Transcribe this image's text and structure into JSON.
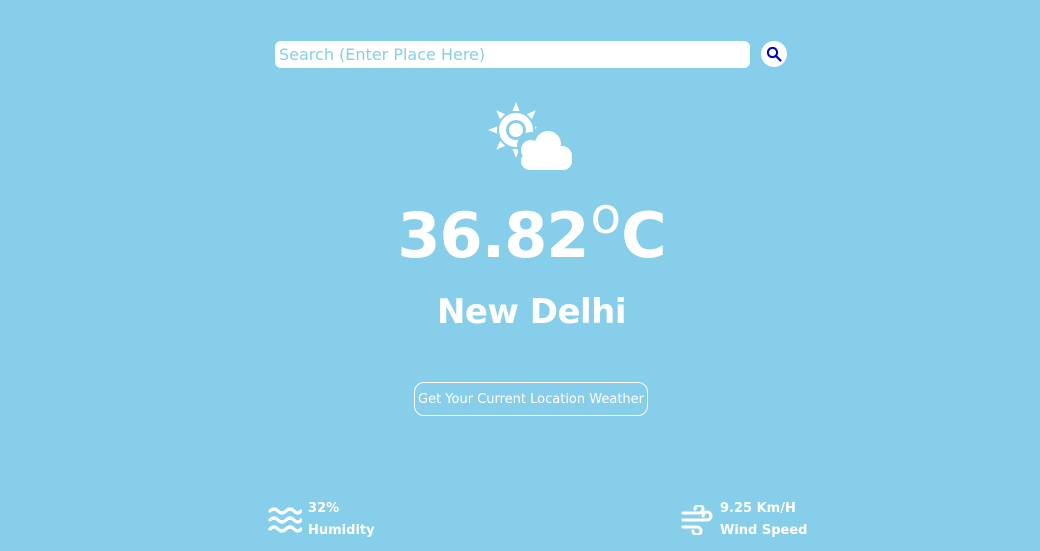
{
  "search": {
    "placeholder": "Search (Enter Place Here)",
    "icon": "search-icon"
  },
  "weather": {
    "icon": "sun-cloud-icon",
    "temperature_value": "36.82",
    "temperature_degree": "o",
    "temperature_unit": "C",
    "city": "New Delhi"
  },
  "location_button": {
    "label": "Get Your Current Location Weather"
  },
  "stats": {
    "humidity": {
      "icon": "water-waves-icon",
      "value": "32%",
      "label": "Humidity"
    },
    "wind": {
      "icon": "wind-icon",
      "value": "9.25 Km/H",
      "label": "Wind Speed"
    }
  },
  "colors": {
    "background": "#87ceeb",
    "foreground": "#ffffff",
    "search_icon": "#0000cd"
  }
}
